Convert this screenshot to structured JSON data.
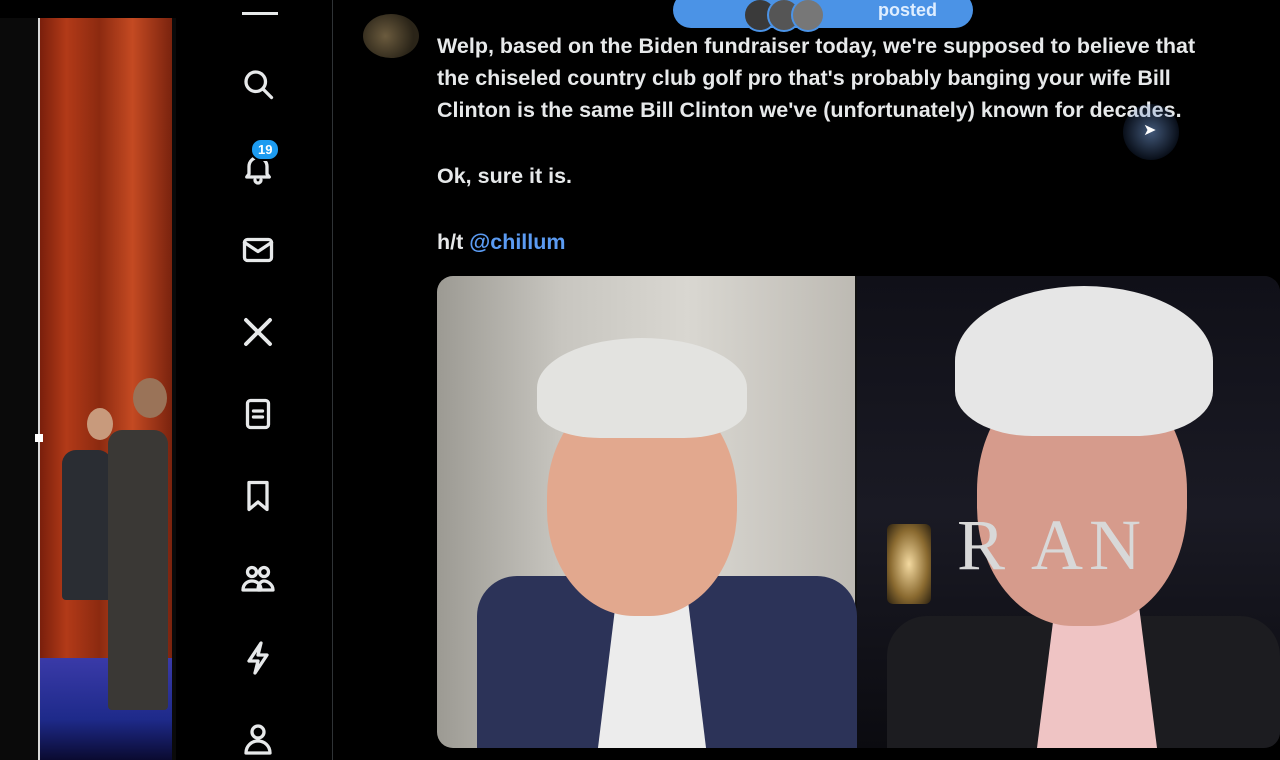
{
  "video": {
    "description_icon": "stage-video-thumbnail"
  },
  "nav": {
    "notification_count": "19",
    "items": [
      {
        "name": "home",
        "icon": "home-icon"
      },
      {
        "name": "explore",
        "icon": "search-icon"
      },
      {
        "name": "notifications",
        "icon": "bell-icon"
      },
      {
        "name": "messages",
        "icon": "mail-icon"
      },
      {
        "name": "premium",
        "icon": "x-logo-icon"
      },
      {
        "name": "lists",
        "icon": "list-icon"
      },
      {
        "name": "bookmarks",
        "icon": "bookmark-icon"
      },
      {
        "name": "communities",
        "icon": "people-icon"
      },
      {
        "name": "verified-orgs",
        "icon": "lightning-icon"
      },
      {
        "name": "profile",
        "icon": "person-icon"
      }
    ]
  },
  "tweet": {
    "posted_label": "posted",
    "line1": "Welp, based on the Biden fundraiser today, we're supposed to believe that",
    "line2": "the chiseled country club golf pro that's probably banging your wife Bill",
    "line3": "Clinton is the same Bill Clinton we've (unfortunately) known for decades.",
    "para2": "Ok, sure it is.",
    "ht_prefix": "h/t",
    "ht_handle": "@chillum"
  },
  "media": {
    "right_sign_text": "R        AN"
  },
  "colors": {
    "accent": "#1d9bf0",
    "link": "#5b9bf2",
    "background": "#000000",
    "text": "#e7e9ea"
  }
}
